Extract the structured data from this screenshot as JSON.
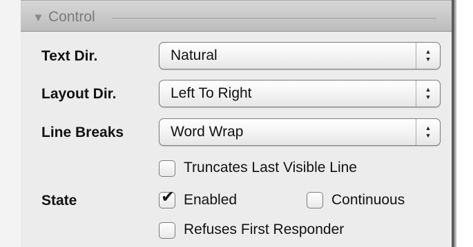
{
  "section": {
    "title": "Control",
    "collapse_icon": "disclosure-triangle-down-icon"
  },
  "rows": {
    "text_dir": {
      "label": "Text Dir.",
      "value": "Natural"
    },
    "layout_dir": {
      "label": "Layout Dir.",
      "value": "Left To Right"
    },
    "line_breaks": {
      "label": "Line Breaks",
      "value": "Word Wrap"
    }
  },
  "checkboxes": {
    "truncates": {
      "label": "Truncates Last Visible Line",
      "checked": false
    },
    "enabled": {
      "label": "Enabled",
      "checked": true
    },
    "continuous": {
      "label": "Continuous",
      "checked": false
    },
    "refuses": {
      "label": "Refuses First Responder",
      "checked": false
    }
  },
  "state_label": "State",
  "icons": {
    "popup_arrows": "up-down-stepper-icon",
    "checkmark": "checkmark-icon"
  },
  "glyphs": {
    "triangle": "▼",
    "arrow_up": "▲",
    "arrow_down": "▼",
    "check": "✔"
  }
}
